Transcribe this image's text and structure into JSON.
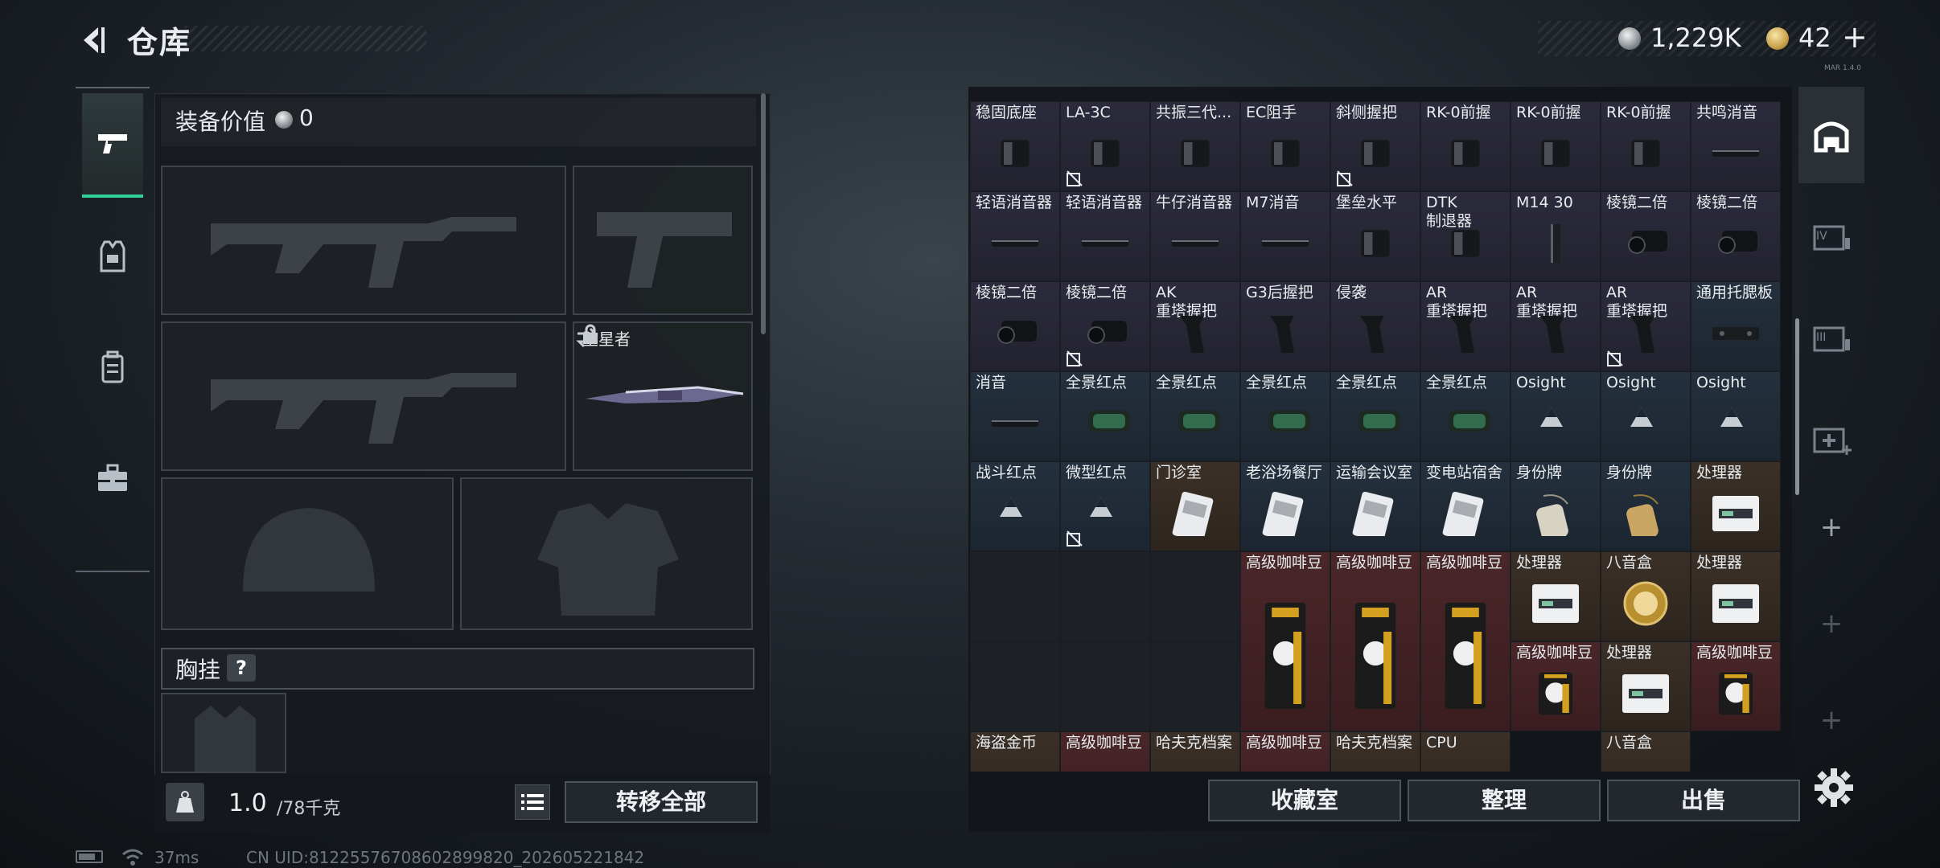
{
  "header": {
    "title": "仓库",
    "coin_amount": "1,229K",
    "gold_amount": "42",
    "gold_plus": "+",
    "version": "MAR 1.4.0"
  },
  "equipment": {
    "label": "装备价值",
    "value": "0",
    "melee_name": "坠星者",
    "chest_label": "胸挂",
    "chest_help": "?",
    "weight_value": "1.0",
    "weight_max": "/78千克",
    "transfer_all": "转移全部"
  },
  "storage": {
    "rows": [
      [
        {
          "label": "稳固底座",
          "rarity": "purple",
          "icon": "bipod-icon",
          "nosell": false
        },
        {
          "label": "LA-3C",
          "rarity": "purple",
          "icon": "laser-icon",
          "nosell": true
        },
        {
          "label": "共振三代...",
          "rarity": "purple",
          "icon": "grip-icon",
          "nosell": false
        },
        {
          "label": "EC阻手",
          "rarity": "purple",
          "icon": "handstop-icon",
          "nosell": false
        },
        {
          "label": "斜侧握把",
          "rarity": "purple",
          "icon": "angled-grip-icon",
          "nosell": true
        },
        {
          "label": "RK-0前握",
          "rarity": "purple",
          "icon": "foregrip-icon",
          "nosell": false
        },
        {
          "label": "RK-0前握",
          "rarity": "purple",
          "icon": "foregrip-icon",
          "nosell": false
        },
        {
          "label": "RK-0前握",
          "rarity": "purple",
          "icon": "foregrip-icon",
          "nosell": false
        },
        {
          "label": "共鸣消音",
          "rarity": "purple",
          "icon": "suppressor-icon",
          "nosell": false
        }
      ],
      [
        {
          "label": "轻语消音器",
          "rarity": "purple",
          "icon": "suppressor-icon",
          "nosell": false
        },
        {
          "label": "轻语消音器",
          "rarity": "purple",
          "icon": "suppressor-icon",
          "nosell": false
        },
        {
          "label": "牛仔消音器",
          "rarity": "purple",
          "icon": "suppressor-icon",
          "nosell": false
        },
        {
          "label": "M7消音",
          "rarity": "purple",
          "icon": "suppressor-icon",
          "nosell": false
        },
        {
          "label": "堡垒水平",
          "rarity": "purple",
          "icon": "muzzle-icon",
          "nosell": false
        },
        {
          "label": "DTK\n制退器",
          "rarity": "purple",
          "icon": "muzzle-brake-icon",
          "nosell": false
        },
        {
          "label": "M14 30",
          "rarity": "purple",
          "icon": "magazine-icon",
          "nosell": false
        },
        {
          "label": "棱镜二倍",
          "rarity": "purple",
          "icon": "scope-icon",
          "nosell": false
        },
        {
          "label": "棱镜二倍",
          "rarity": "purple",
          "icon": "scope-icon",
          "nosell": false
        }
      ],
      [
        {
          "label": "棱镜二倍",
          "rarity": "purple",
          "icon": "scope-icon",
          "nosell": false
        },
        {
          "label": "棱镜二倍",
          "rarity": "purple",
          "icon": "scope-icon",
          "nosell": true
        },
        {
          "label": "AK\n重塔握把",
          "rarity": "purple",
          "icon": "pistol-grip-icon",
          "nosell": false
        },
        {
          "label": "G3后握把",
          "rarity": "purple",
          "icon": "pistol-grip-icon",
          "nosell": false
        },
        {
          "label": "侵袭",
          "rarity": "purple",
          "icon": "pistol-grip-icon",
          "nosell": false
        },
        {
          "label": "AR\n重塔握把",
          "rarity": "purple",
          "icon": "pistol-grip-icon",
          "nosell": false
        },
        {
          "label": "AR\n重塔握把",
          "rarity": "purple",
          "icon": "pistol-grip-icon",
          "nosell": false
        },
        {
          "label": "AR\n重塔握把",
          "rarity": "purple",
          "icon": "pistol-grip-icon",
          "nosell": true
        },
        {
          "label": "通用托腮板",
          "rarity": "blue",
          "icon": "cheek-rest-icon",
          "nosell": false
        }
      ],
      [
        {
          "label": "消音",
          "rarity": "blue",
          "icon": "suppressor-icon",
          "nosell": false
        },
        {
          "label": "全景红点",
          "rarity": "blue",
          "icon": "red-dot-icon",
          "nosell": false
        },
        {
          "label": "全景红点",
          "rarity": "blue",
          "icon": "red-dot-icon",
          "nosell": false
        },
        {
          "label": "全景红点",
          "rarity": "blue",
          "icon": "red-dot-icon",
          "nosell": false
        },
        {
          "label": "全景红点",
          "rarity": "blue",
          "icon": "red-dot-icon",
          "nosell": false
        },
        {
          "label": "全景红点",
          "rarity": "blue",
          "icon": "red-dot-icon",
          "nosell": false
        },
        {
          "label": "Osight",
          "rarity": "blue",
          "icon": "triangle-placeholder-icon",
          "nosell": false
        },
        {
          "label": "Osight",
          "rarity": "blue",
          "icon": "triangle-placeholder-icon",
          "nosell": false
        },
        {
          "label": "Osight",
          "rarity": "blue",
          "icon": "triangle-placeholder-icon",
          "nosell": false
        }
      ],
      [
        {
          "label": "战斗红点",
          "rarity": "blue",
          "icon": "triangle-placeholder-icon",
          "nosell": false
        },
        {
          "label": "微型红点",
          "rarity": "blue",
          "icon": "triangle-placeholder-icon",
          "nosell": true
        },
        {
          "label": "门诊室",
          "rarity": "gold",
          "icon": "keycard-icon",
          "nosell": false
        },
        {
          "label": "老浴场餐厅",
          "rarity": "blue",
          "icon": "keycard-icon",
          "nosell": false
        },
        {
          "label": "运输会议室",
          "rarity": "blue",
          "icon": "keycard-icon",
          "nosell": false
        },
        {
          "label": "变电站宿舍",
          "rarity": "blue",
          "icon": "keycard-icon",
          "nosell": false
        },
        {
          "label": "身份牌",
          "rarity": "blue",
          "icon": "dog-tag-icon",
          "nosell": false
        },
        {
          "label": "身份牌",
          "rarity": "blue",
          "icon": "gold-dog-tag-icon",
          "nosell": false
        },
        {
          "label": "处理器",
          "rarity": "gold",
          "icon": "processor-icon",
          "nosell": false
        }
      ]
    ],
    "big_items": [
      {
        "label": "高级咖啡豆",
        "icon": "coffee-bag-icon"
      },
      {
        "label": "高级咖啡豆",
        "icon": "coffee-bag-icon"
      },
      {
        "label": "高级咖啡豆",
        "icon": "coffee-bag-icon"
      }
    ],
    "small_items": [
      {
        "label": "处理器",
        "rarity": "gold",
        "icon": "processor-icon"
      },
      {
        "label": "八音盒",
        "rarity": "gold",
        "icon": "music-box-icon"
      },
      {
        "label": "处理器",
        "rarity": "gold",
        "icon": "processor-icon"
      },
      {
        "label": "高级咖啡豆",
        "rarity": "red",
        "icon": "coffee-bag-icon"
      },
      {
        "label": "处理器",
        "rarity": "gold",
        "icon": "processor-icon"
      },
      {
        "label": "高级咖啡豆",
        "rarity": "red",
        "icon": "coffee-bag-icon"
      }
    ],
    "bottom_row": [
      {
        "label": "海盗金币",
        "rarity": "gold"
      },
      {
        "label": "高级咖啡豆",
        "rarity": "red"
      },
      {
        "label": "哈夫克档案",
        "rarity": "gold"
      },
      {
        "label": "高级咖啡豆",
        "rarity": "red"
      },
      {
        "label": "哈夫克档案",
        "rarity": "gold"
      },
      {
        "label": "CPU",
        "rarity": "gold"
      },
      {
        "label": "八音盒",
        "rarity": "gold"
      }
    ],
    "buttons": {
      "collection": "收藏室",
      "organize": "整理",
      "sell": "出售"
    }
  },
  "status": {
    "ping": "37ms",
    "uid": "CN UID:81225576708602899820_202605221842"
  },
  "colors": {
    "accent": "#2fd29a",
    "purple": "#2c2b3c",
    "blue": "#24303d",
    "gold": "#3b3027",
    "red": "#4a2629"
  }
}
